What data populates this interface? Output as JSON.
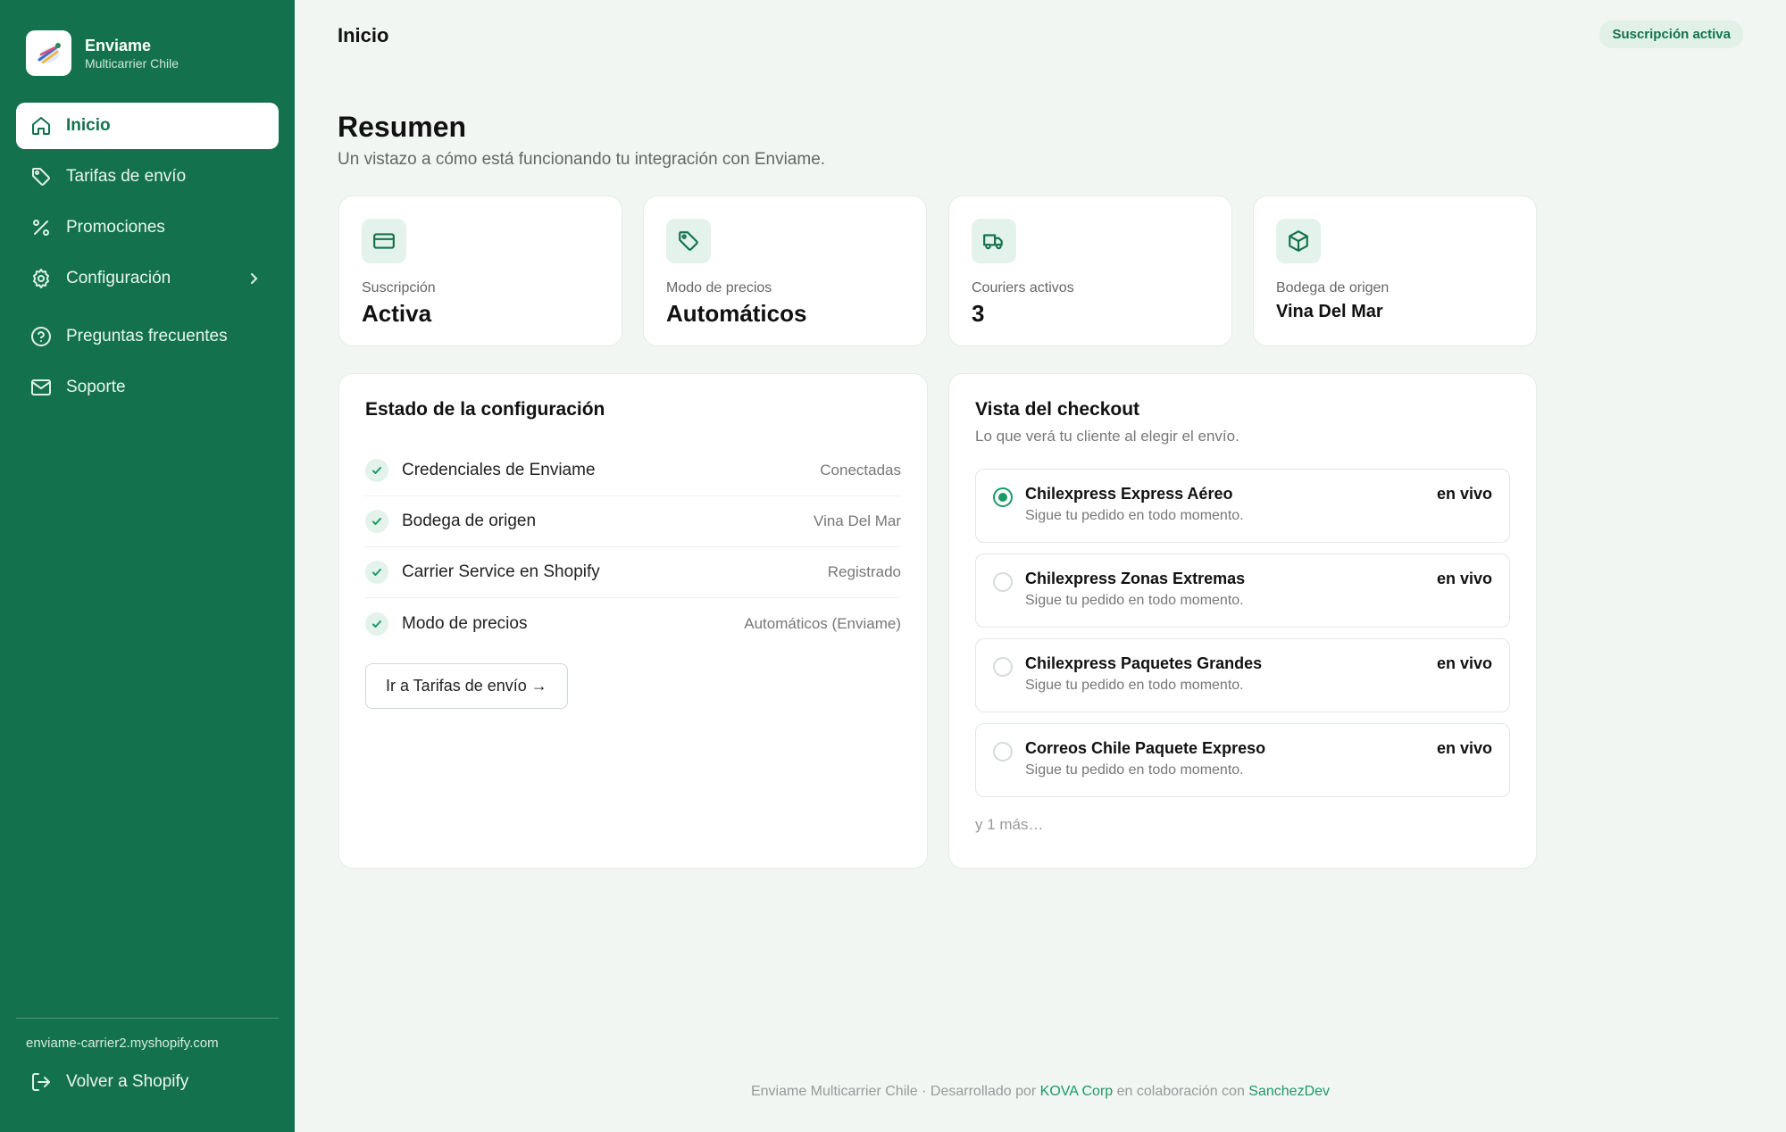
{
  "brand": {
    "name": "Enviame",
    "subtitle": "Multicarrier Chile"
  },
  "nav": {
    "items": [
      {
        "label": "Inicio",
        "icon": "home-icon"
      },
      {
        "label": "Tarifas de envío",
        "icon": "tag-icon"
      },
      {
        "label": "Promociones",
        "icon": "percent-icon"
      },
      {
        "label": "Configuración",
        "icon": "gear-icon"
      },
      {
        "label": "Preguntas frecuentes",
        "icon": "help-circle-icon"
      },
      {
        "label": "Soporte",
        "icon": "mail-icon"
      }
    ],
    "store_url": "enviame-carrier2.myshopify.com",
    "back_label": "Volver a Shopify"
  },
  "header": {
    "title": "Inicio",
    "badge": "Suscripción activa"
  },
  "summary": {
    "title": "Resumen",
    "subtitle": "Un vistazo a cómo está funcionando tu integración con Enviame."
  },
  "stats": [
    {
      "label": "Suscripción",
      "value": "Activa",
      "icon": "credit-card-icon"
    },
    {
      "label": "Modo de precios",
      "value": "Automáticos",
      "icon": "tag-icon"
    },
    {
      "label": "Couriers activos",
      "value": "3",
      "icon": "truck-icon"
    },
    {
      "label": "Bodega de origen",
      "value": "Vina Del Mar",
      "icon": "box-icon"
    }
  ],
  "config": {
    "title": "Estado de la configuración",
    "rows": [
      {
        "label": "Credenciales de Enviame",
        "value": "Conectadas"
      },
      {
        "label": "Bodega de origen",
        "value": "Vina Del Mar"
      },
      {
        "label": "Carrier Service en Shopify",
        "value": "Registrado"
      },
      {
        "label": "Modo de precios",
        "value": "Automáticos (Enviame)"
      }
    ],
    "button": "Ir a Tarifas de envío →"
  },
  "checkout": {
    "title": "Vista del checkout",
    "subtitle": "Lo que verá tu cliente al elegir el envío.",
    "options": [
      {
        "name": "Chilexpress Express Aéreo",
        "desc": "Sigue tu pedido en todo momento.",
        "tag": "en vivo",
        "selected": true
      },
      {
        "name": "Chilexpress Zonas Extremas",
        "desc": "Sigue tu pedido en todo momento.",
        "tag": "en vivo",
        "selected": false
      },
      {
        "name": "Chilexpress Paquetes Grandes",
        "desc": "Sigue tu pedido en todo momento.",
        "tag": "en vivo",
        "selected": false
      },
      {
        "name": "Correos Chile Paquete Expreso",
        "desc": "Sigue tu pedido en todo momento.",
        "tag": "en vivo",
        "selected": false
      }
    ],
    "more": "y 1 más…"
  },
  "footer": {
    "prefix": "Enviame Multicarrier Chile · Desarrollado por",
    "company": "KOVA Corp",
    "middle": "en colaboración con",
    "partner": "SanchezDev"
  },
  "colors": {
    "sidebar": "#13724d",
    "accent": "#1a9a66",
    "background": "#f1f6f3"
  }
}
